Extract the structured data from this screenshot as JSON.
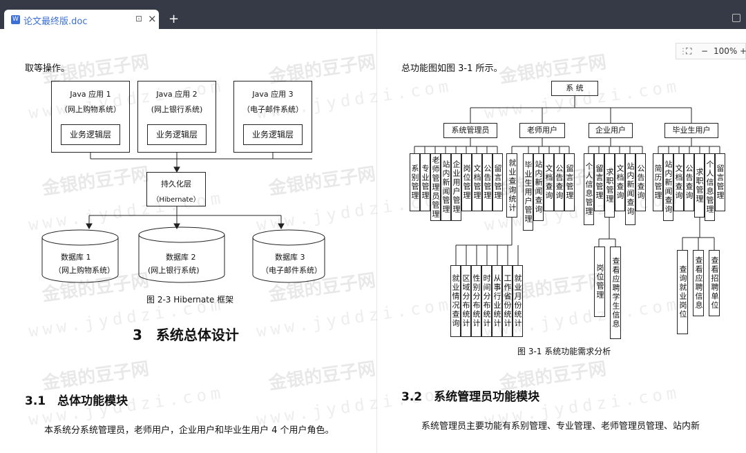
{
  "tab": {
    "title": "论文最终版.doc",
    "new_tab": "+"
  },
  "zoom": {
    "minus": "−",
    "value": "100%",
    "plus": "+"
  },
  "left_page": {
    "intro": "取等操作。",
    "apps": [
      {
        "name": "Java 应用 1",
        "sub": "（网上购物系统）",
        "layer": "业务逻辑层"
      },
      {
        "name": "Java 应用 2",
        "sub": "(网上银行系统)",
        "layer": "业务逻辑层"
      },
      {
        "name": "Java 应用 3",
        "sub": "（电子邮件系统）",
        "layer": "业务逻辑层"
      }
    ],
    "persistence": {
      "name": "持久化层",
      "sub": "（Hibernate）"
    },
    "databases": [
      {
        "name": "数据库 1",
        "sub": "（网上购物系统）"
      },
      {
        "name": "数据库 2",
        "sub": "(网上银行系统)"
      },
      {
        "name": "数据库 3",
        "sub": "（电子邮件系统）"
      }
    ],
    "figure_caption": "图 2-3 Hibernate 框架",
    "chapter": "3　系统总体设计",
    "section": "3.1　总体功能模块",
    "body": "本系统分系统管理员，老师用户，企业用户和毕业生用户 4 个用户角色。"
  },
  "right_page": {
    "intro": "总功能图如图 3-1 所示。",
    "root": "系 统",
    "roles": [
      {
        "name": "系统管理员",
        "children": [
          "系别管理",
          "专业管理",
          "老师管理员管理",
          "站内新闻管理",
          "企业用户管理",
          "岗位管理",
          "文档管理",
          "公告管理",
          "留言管理"
        ]
      },
      {
        "name": "老师用户",
        "children": [
          "就业查询统计",
          "毕业生用户管理",
          "站内新闻查询",
          "文档查询",
          "公告查询",
          "留言管理"
        ]
      },
      {
        "name": "企业用户",
        "children": [
          "个人信息管理",
          "留言管理",
          "求职管理",
          "文档查询",
          "站内新闻查询",
          "公告查询"
        ]
      },
      {
        "name": "毕业生用户",
        "children": [
          "简历管理",
          "站内新闻查询",
          "文档查询",
          "公告查询",
          "求职管理",
          "个人信息管理",
          "留言管理"
        ]
      }
    ],
    "stats": [
      "就业情况查询",
      "区域分布统计",
      "性别分布统计",
      "时间分布统计",
      "从事行业统计",
      "工作省份统计",
      "就业月份统计"
    ],
    "job_sub": [
      "岗位管理",
      "查看应聘学生信息"
    ],
    "grad_sub": [
      "查询就业岗位",
      "查看应聘信息",
      "查看招聘单位"
    ],
    "figure_caption": "图 3-1 系统功能需求分析",
    "section": "3.2　系统管理员功能模块",
    "body": "系统管理员主要功能有系别管理、专业管理、老师管理员管理、站内新"
  },
  "watermark": {
    "cn": "金银的豆子网",
    "url": "www.jyddzi.com"
  }
}
